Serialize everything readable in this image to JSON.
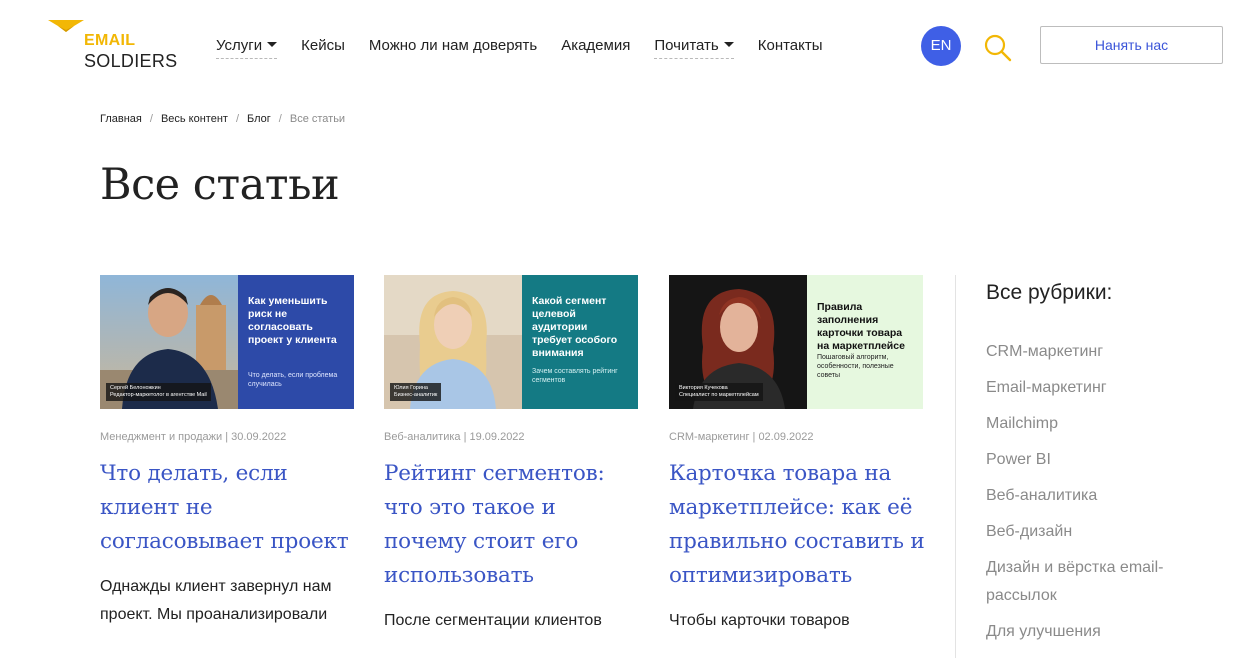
{
  "logo": {
    "line1": "EMAIL",
    "line2": "SOLDIERS",
    "accent": "#f2b705"
  },
  "nav": {
    "items": [
      {
        "label": "Услуги",
        "dropdown": true
      },
      {
        "label": "Кейсы",
        "dropdown": false
      },
      {
        "label": "Можно ли нам доверять",
        "dropdown": false
      },
      {
        "label": "Академия",
        "dropdown": false
      },
      {
        "label": "Почитать",
        "dropdown": true
      },
      {
        "label": "Контакты",
        "dropdown": false
      }
    ]
  },
  "header": {
    "lang": "EN",
    "hire_label": "Нанять нас",
    "search_icon": "search-icon"
  },
  "breadcrumb": [
    "Главная",
    "Весь контент",
    "Блог",
    "Все статьи"
  ],
  "page_title": "Все статьи",
  "cards": [
    {
      "meta": "Менеджмент и продажи | 30.09.2022",
      "title": "Что делать, если клиент не согласовывает проект",
      "excerpt": "Однажды клиент завернул нам проект. Мы проанализировали",
      "thumb": {
        "title": "Как уменьшить риск не согласовать проект у клиента",
        "sub": "Что делать, если проблема случилась",
        "badge_name": "Сергей Белоножкин",
        "badge_role": "Редактор-маркетолог в агентстве Mail"
      }
    },
    {
      "meta": "Веб-аналитика | 19.09.2022",
      "title": "Рейтинг сегментов: что это такое и почему стоит его использовать",
      "excerpt": "После сегментации клиентов",
      "thumb": {
        "title": "Какой сегмент целевой аудитории требует особого внимания",
        "sub": "Зачем составлять рейтинг сегментов",
        "badge_name": "Юлия Горина",
        "badge_role": "Бизнес-аналитик"
      }
    },
    {
      "meta": "CRM-маркетинг | 02.09.2022",
      "title": "Карточка товара на маркетплейсе: как её правильно составить и оптимизировать",
      "excerpt": "Чтобы карточки товаров",
      "thumb": {
        "title": "Правила заполнения карточки товара на маркетплейсе",
        "sub": "Пошаговый алгоритм, особенности, полезные советы",
        "badge_name": "Виктория Кучекова",
        "badge_role": "Специалист по маркетплейсам"
      }
    }
  ],
  "sidebar": {
    "title": "Все рубрики:",
    "categories": [
      "CRM-маркетинг",
      "Email-маркетинг",
      "Mailchimp",
      "Power BI",
      "Веб-аналитика",
      "Веб-дизайн",
      "Дизайн и вёрстка email-рассылок",
      "Для улучшения"
    ]
  },
  "colors": {
    "link": "#3a55c5",
    "lang_bg": "#3f5fe6",
    "search": "#f2b705"
  }
}
